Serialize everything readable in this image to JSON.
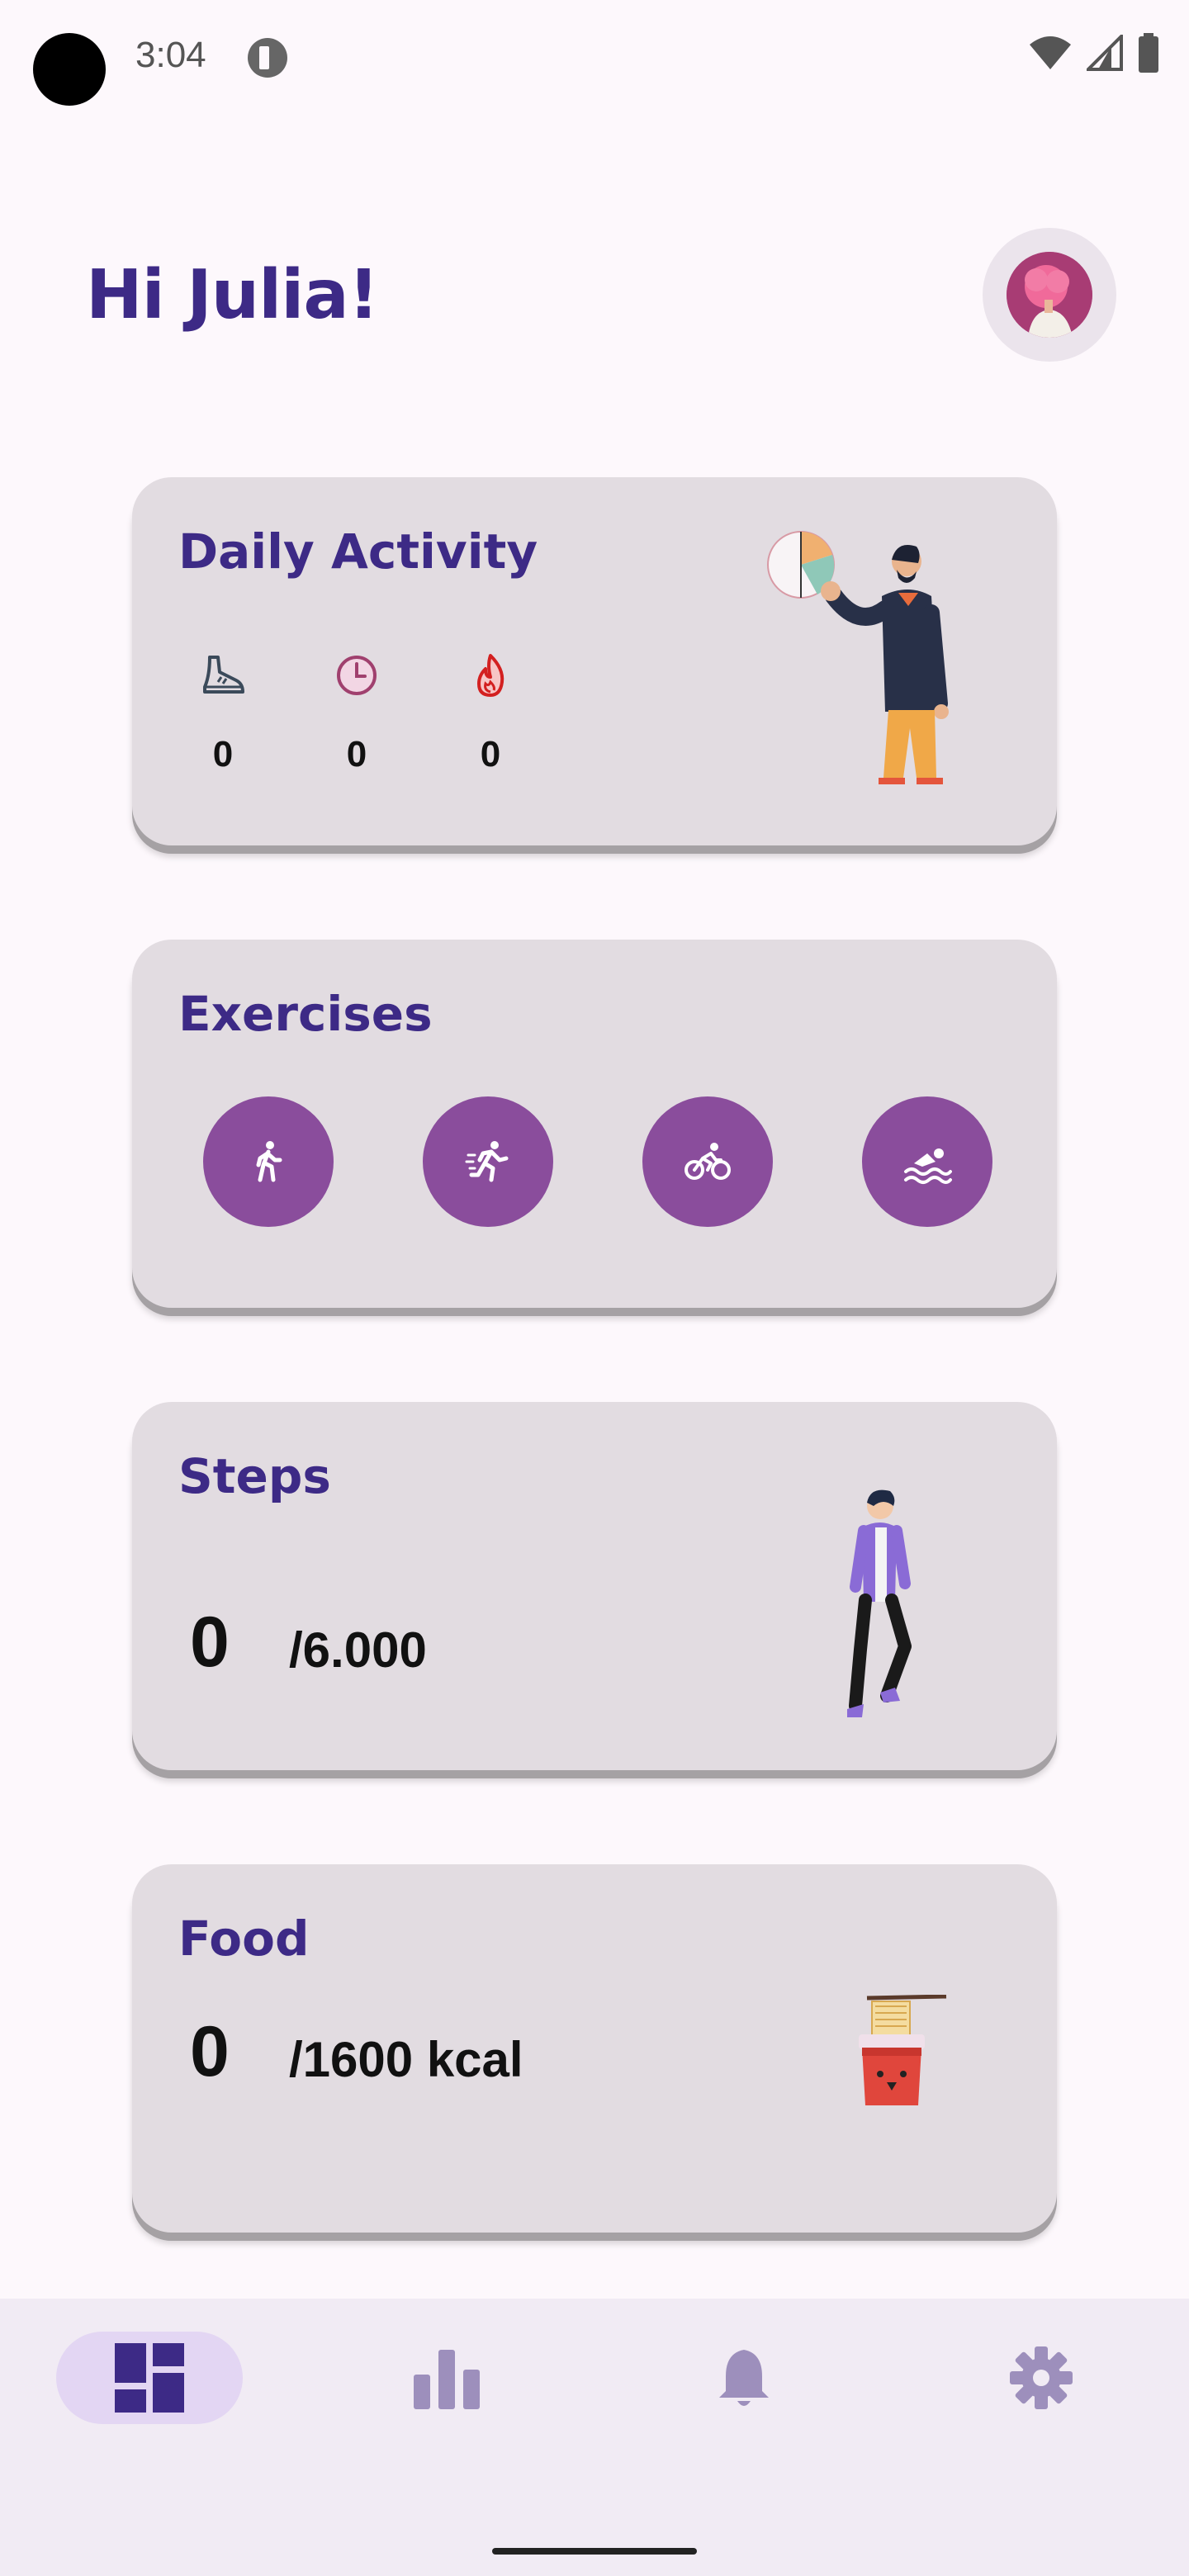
{
  "status_bar": {
    "time": "3:04"
  },
  "header": {
    "greeting": "Hi Julia!"
  },
  "daily_activity": {
    "title": "Daily Activity",
    "metrics": [
      {
        "icon": "shoe-icon",
        "value": "0"
      },
      {
        "icon": "clock-icon",
        "value": "0"
      },
      {
        "icon": "flame-icon",
        "value": "0"
      }
    ]
  },
  "exercises": {
    "title": "Exercises",
    "items": [
      {
        "icon": "walk-icon"
      },
      {
        "icon": "run-icon"
      },
      {
        "icon": "bike-icon"
      },
      {
        "icon": "swim-icon"
      }
    ]
  },
  "steps": {
    "title": "Steps",
    "value": "0",
    "goal": "/6.000"
  },
  "food": {
    "title": "Food",
    "value": "0",
    "goal": "/1600 kcal"
  },
  "bottom_nav": {
    "items": [
      {
        "icon": "dashboard-icon",
        "active": true
      },
      {
        "icon": "bar-chart-icon",
        "active": false
      },
      {
        "icon": "bell-icon",
        "active": false
      },
      {
        "icon": "gear-icon",
        "active": false
      }
    ]
  },
  "colors": {
    "title": "#3d2a86",
    "card": "#e2dce1",
    "exercise_button": "#8a4d9c",
    "nav_active": "#e3d6f3",
    "nav_icon_active": "#3d2a86",
    "nav_icon_inactive": "#9d8fbc"
  }
}
